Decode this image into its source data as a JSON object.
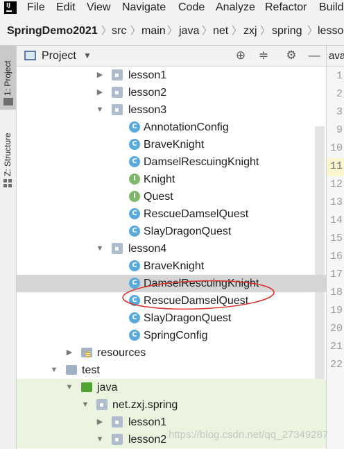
{
  "menu": [
    "File",
    "Edit",
    "View",
    "Navigate",
    "Code",
    "Analyze",
    "Refactor",
    "Build"
  ],
  "breadcrumb": [
    "SpringDemo2021",
    "src",
    "main",
    "java",
    "net",
    "zxj",
    "spring",
    "lesso"
  ],
  "toolstrip": {
    "project_label": "1: Project",
    "structure_label": "Z: Structure"
  },
  "project_panel": {
    "title": "Project",
    "dropdown_icon": "chevron-down-icon"
  },
  "editor": {
    "tab_partial": "ava",
    "line_numbers": [
      "1",
      "2",
      "3",
      "9",
      "10",
      "11",
      "12",
      "13",
      "14",
      "15",
      "16",
      "17",
      "18",
      "19",
      "20",
      "21",
      "22"
    ]
  },
  "tree": {
    "lesson1": "lesson1",
    "lesson2": "lesson2",
    "lesson3": "lesson3",
    "lesson3_items": [
      "AnnotationConfig",
      "BraveKnight",
      "DamselRescuingKnight",
      "Knight",
      "Quest",
      "RescueDamselQuest",
      "SlayDragonQuest"
    ],
    "lesson4": "lesson4",
    "lesson4_items": [
      "BraveKnight",
      "DamselRescuingKnight",
      "RescueDamselQuest",
      "SlayDragonQuest",
      "SpringConfig"
    ],
    "resources": "resources",
    "test": "test",
    "java": "java",
    "pkg": "net.zxj.spring",
    "test_lesson1": "lesson1",
    "test_lesson2": "lesson2"
  },
  "badges": {
    "class": "C",
    "interface": "I"
  },
  "colors": {
    "selection": "#d5d5d5",
    "test_background": "#eaf4df",
    "annotation_ellipse": "#d9302a",
    "class_badge": "#58a9dc",
    "interface_badge": "#7fb86b"
  },
  "watermark": "https://blog.csdn.net/qq_27349287"
}
